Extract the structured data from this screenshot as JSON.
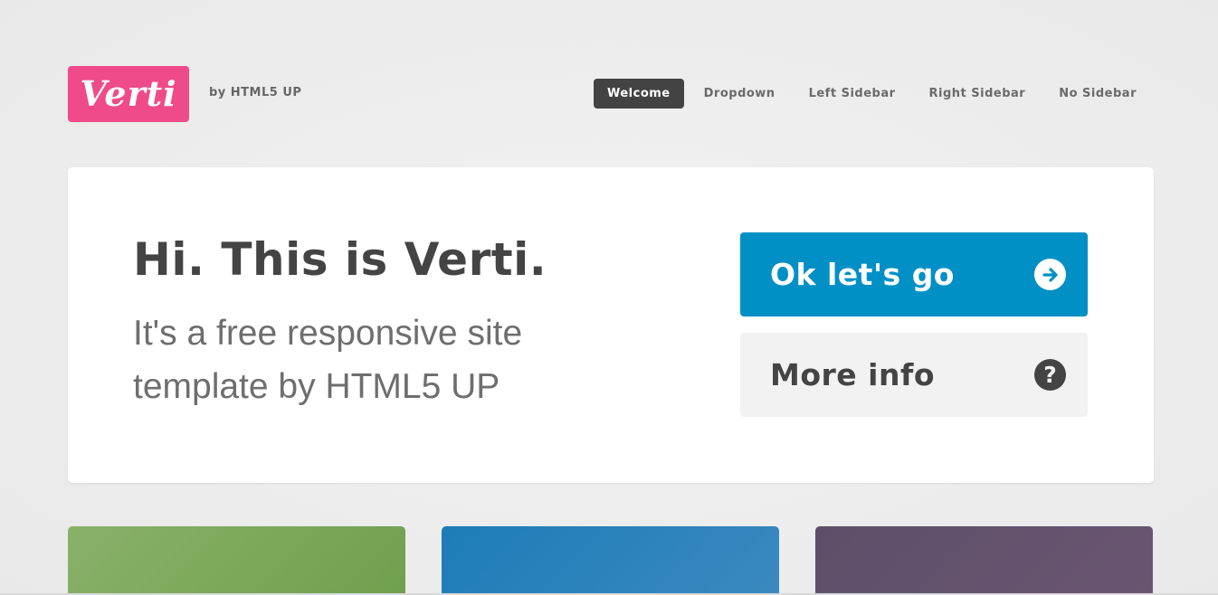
{
  "header": {
    "logo_text": "Verti",
    "tagline": "by HTML5 UP",
    "nav": [
      {
        "label": "Welcome",
        "active": true
      },
      {
        "label": "Dropdown",
        "active": false
      },
      {
        "label": "Left Sidebar",
        "active": false
      },
      {
        "label": "Right Sidebar",
        "active": false
      },
      {
        "label": "No Sidebar",
        "active": false
      }
    ]
  },
  "banner": {
    "title": "Hi. This is Verti.",
    "subtitle_line1": "It's a free responsive site",
    "subtitle_line2": "template by HTML5 UP",
    "primary_button": {
      "label": "Ok let's go",
      "icon": "arrow-right-circle-icon"
    },
    "secondary_button": {
      "label": "More info",
      "icon": "question-circle-icon"
    }
  },
  "colors": {
    "brand": "#ef4b8a",
    "primary": "#0090c5",
    "nav_active": "#434343"
  },
  "tiles": [
    "green",
    "blue",
    "purple"
  ]
}
